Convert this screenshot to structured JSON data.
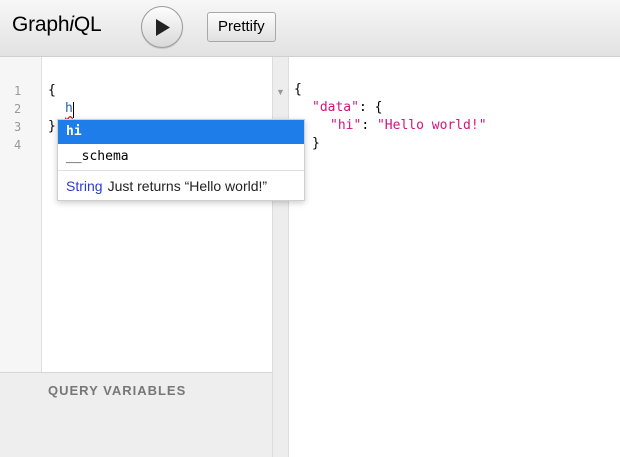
{
  "app": {
    "logo_prefix": "Graph",
    "logo_italic": "i",
    "logo_suffix": "QL"
  },
  "toolbar": {
    "prettify_label": "Prettify",
    "run_icon": "play-icon"
  },
  "editor": {
    "line_numbers": [
      "1",
      "2",
      "3",
      "4"
    ],
    "lines": [
      "{",
      "h",
      "}"
    ]
  },
  "autocomplete": {
    "items": [
      "hi",
      "__schema"
    ],
    "selected": "hi",
    "type": "String",
    "description": "Just returns “Hello world!”"
  },
  "variables": {
    "title": "QUERY VARIABLES"
  },
  "result": {
    "lines": [
      "{",
      "\"data\": {",
      "\"hi\": \"Hello world!\"",
      "}"
    ],
    "key_data": "\"data\"",
    "key_hi": "\"hi\"",
    "value_hi": "\"Hello world!\""
  }
}
